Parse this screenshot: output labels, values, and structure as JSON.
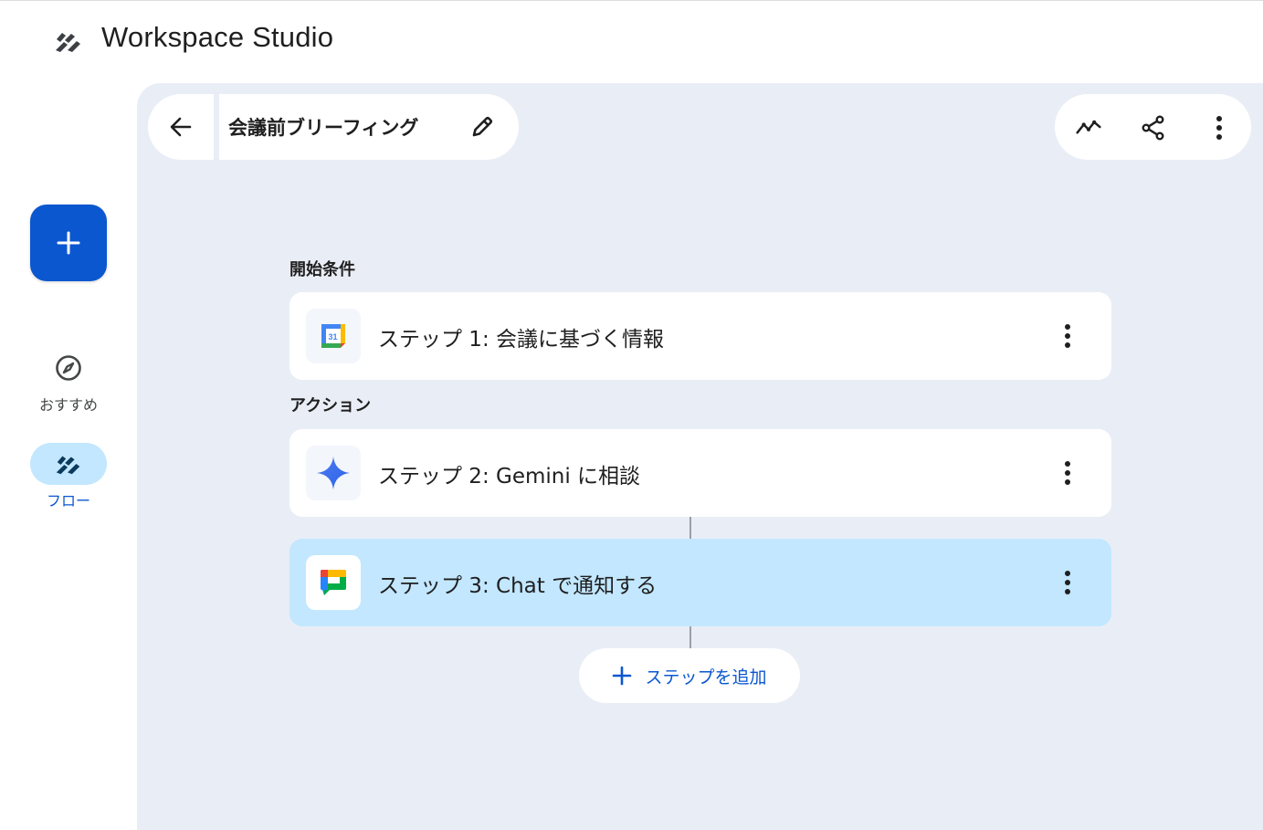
{
  "app": {
    "title": "Workspace Studio"
  },
  "rail": {
    "items": [
      {
        "label": "おすすめ",
        "icon": "compass-icon",
        "active": false
      },
      {
        "label": "フロー",
        "icon": "flows-icon",
        "active": true
      }
    ]
  },
  "flow": {
    "name": "会議前ブリーフィング"
  },
  "sections": {
    "trigger": "開始条件",
    "actions": "アクション"
  },
  "steps": [
    {
      "label": "ステップ 1: 会議に基づく情報",
      "icon": "google-calendar-icon",
      "calendar_day": "31"
    },
    {
      "label": "ステップ 2: Gemini に相談",
      "icon": "gemini-icon"
    },
    {
      "label": "ステップ 3: Chat で通知する",
      "icon": "google-chat-icon",
      "selected": true
    }
  ],
  "add_step": {
    "label": "ステップを追加"
  },
  "colors": {
    "primary": "#0b57d0",
    "canvas": "#e9eef6",
    "selected": "#c2e7ff"
  }
}
